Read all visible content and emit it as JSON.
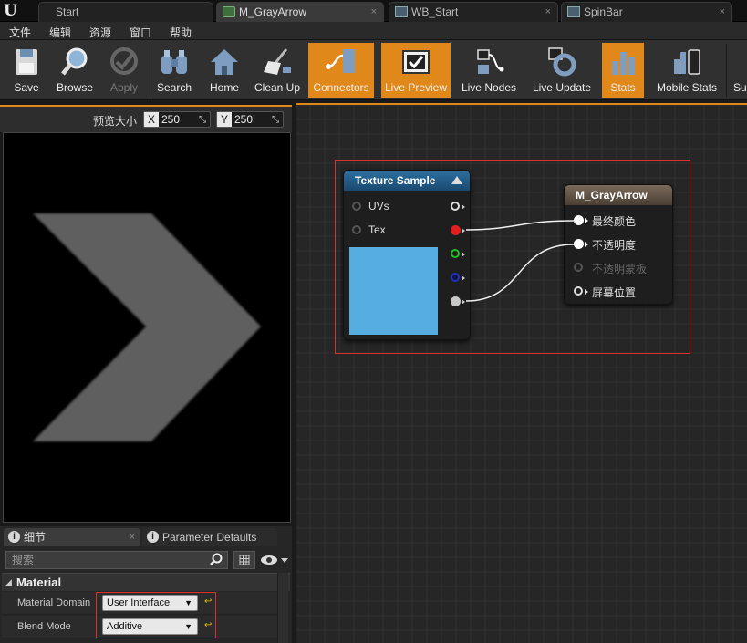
{
  "tabs": [
    {
      "label": "Start"
    },
    {
      "label": "M_GrayArrow"
    },
    {
      "label": "WB_Start"
    },
    {
      "label": "SpinBar"
    }
  ],
  "tab_close_glyph": "×",
  "menu": [
    "文件",
    "编辑",
    "资源",
    "窗口",
    "帮助"
  ],
  "toolbar": {
    "save": "Save",
    "browse": "Browse",
    "apply": "Apply",
    "search": "Search",
    "home": "Home",
    "clean_up": "Clean Up",
    "connectors": "Connectors",
    "live_preview": "Live Preview",
    "live_nodes": "Live Nodes",
    "live_update": "Live Update",
    "stats": "Stats",
    "mobile_stats": "Mobile Stats",
    "overflow": "Su"
  },
  "preview": {
    "label": "预览大小",
    "x_axis": "X",
    "x_value": "250",
    "y_axis": "Y",
    "y_value": "250"
  },
  "details": {
    "tab_details": "细节",
    "tab_params": "Parameter Defaults",
    "search_placeholder": "搜索",
    "category": "Material",
    "props": [
      {
        "label": "Material Domain",
        "value": "User Interface"
      },
      {
        "label": "Blend Mode",
        "value": "Additive"
      }
    ]
  },
  "graph": {
    "texture_node": {
      "title": "Texture Sample",
      "inputs": [
        "UVs",
        "Tex"
      ]
    },
    "material_node": {
      "title": "M_GrayArrow",
      "inputs": [
        "最终颜色",
        "不透明度",
        "不透明蒙板",
        "屏幕位置"
      ]
    }
  },
  "colors": {
    "accent": "#e0891a",
    "highlight": "#d93030",
    "texture_swatch": "#56aee0",
    "pin_red": "#e02020",
    "pin_green": "#20c020",
    "pin_blue": "#2030c0"
  }
}
